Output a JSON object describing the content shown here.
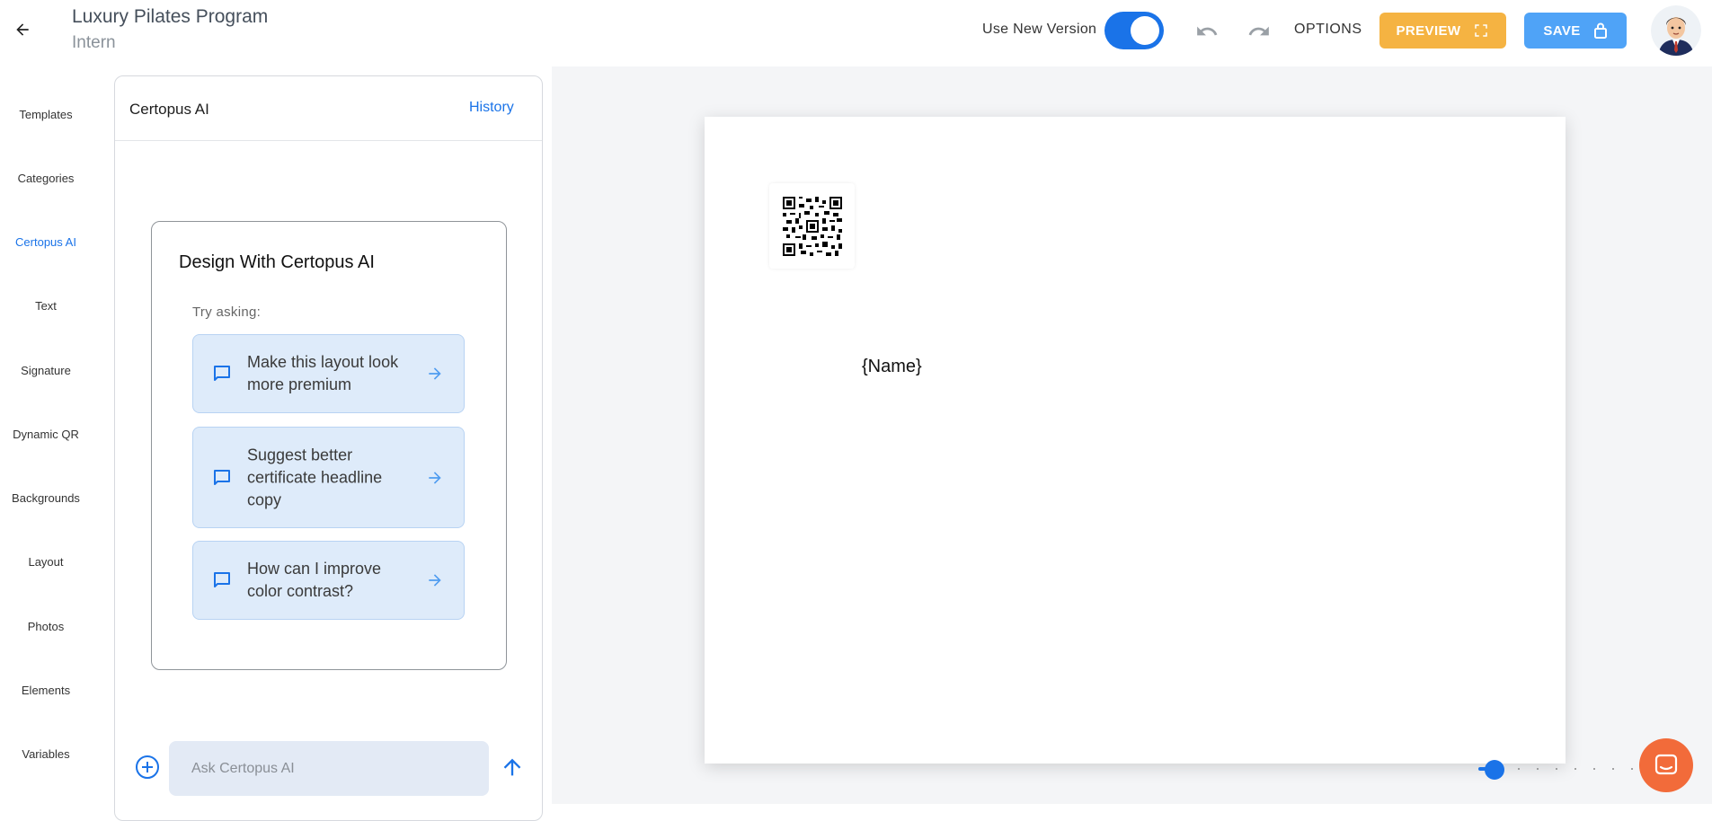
{
  "header": {
    "title": "Luxury Pilates Program",
    "subtitle": "Intern",
    "use_new_version_label": "Use New Version",
    "use_new_version_on": true,
    "options_label": "OPTIONS",
    "preview_label": "PREVIEW",
    "save_label": "SAVE",
    "icons": [
      "arrow-left-icon",
      "undo-icon",
      "redo-icon",
      "fullscreen-icon",
      "lock-icon"
    ]
  },
  "nav": {
    "items": [
      {
        "label": "Templates",
        "active": false
      },
      {
        "label": "Categories",
        "active": false
      },
      {
        "label": "Certopus AI",
        "active": true
      },
      {
        "label": "Text",
        "active": false
      },
      {
        "label": "Signature",
        "active": false
      },
      {
        "label": "Dynamic QR",
        "active": false
      },
      {
        "label": "Backgrounds",
        "active": false
      },
      {
        "label": "Layout",
        "active": false
      },
      {
        "label": "Photos",
        "active": false
      },
      {
        "label": "Elements",
        "active": false
      },
      {
        "label": "Variables",
        "active": false
      }
    ]
  },
  "ai_panel": {
    "title": "Certopus AI",
    "history_label": "History",
    "card_title": "Design With Certopus AI",
    "try_asking": "Try asking:",
    "suggestions": [
      {
        "text": "Make this layout look more premium"
      },
      {
        "text": "Suggest better certificate headline copy"
      },
      {
        "text": "How can I improve color contrast?"
      }
    ],
    "input_placeholder": "Ask Certopus AI"
  },
  "canvas": {
    "name_placeholder": "{Name}",
    "zoom_level": 0.1
  },
  "colors": {
    "accent": "#1a73e8",
    "preview": "#f5b342",
    "save": "#4fa3f7",
    "chat": "#f26b3a"
  }
}
